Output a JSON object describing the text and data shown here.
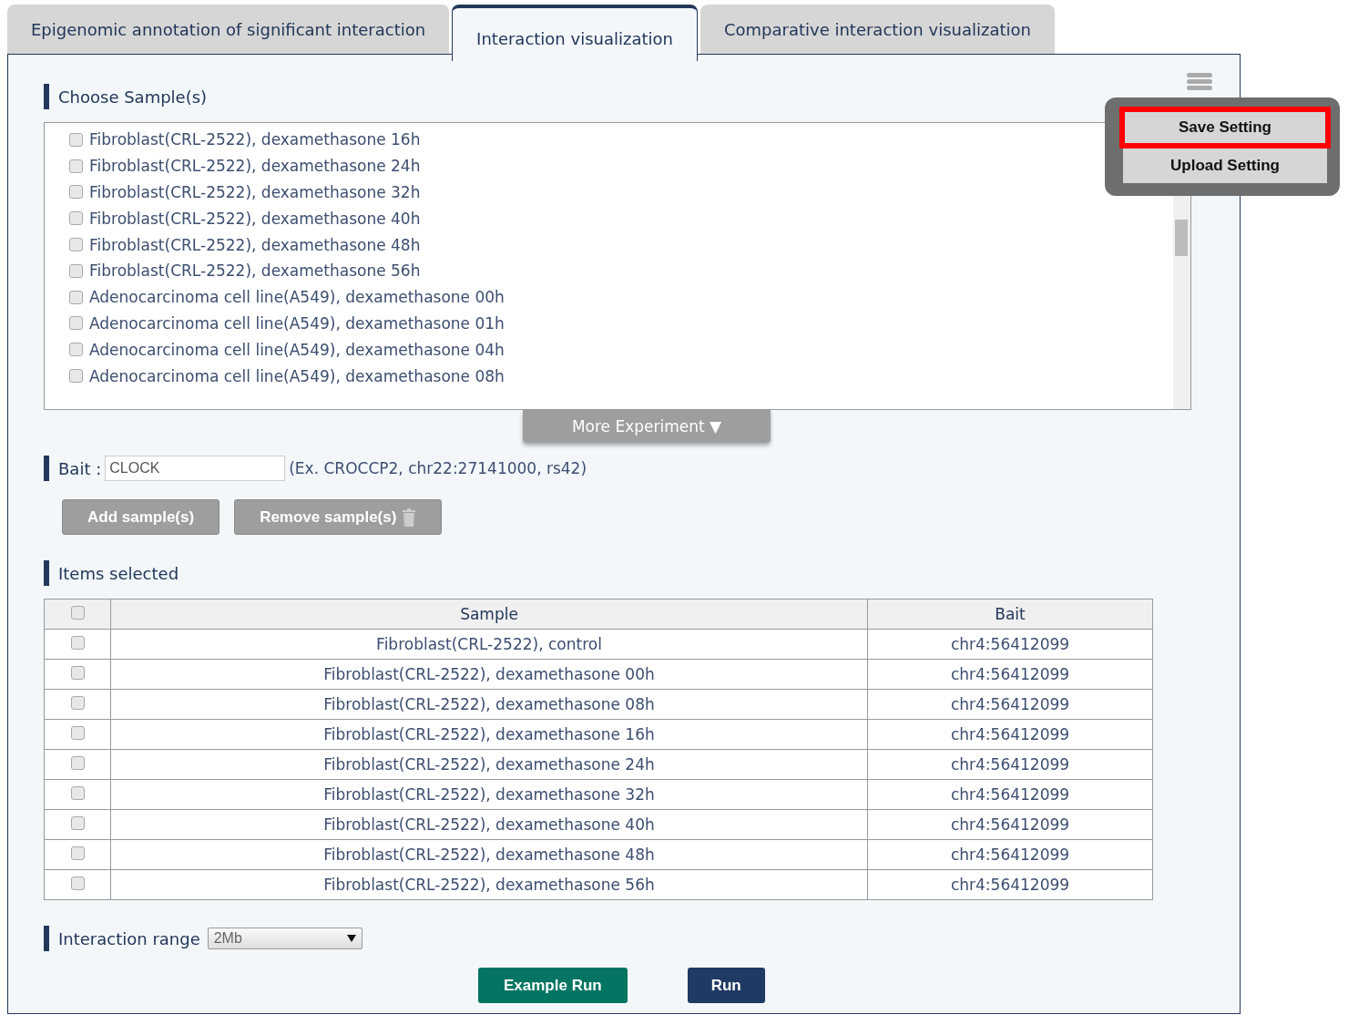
{
  "tabs": [
    {
      "label": "Epigenomic annotation of significant interaction",
      "selected": false
    },
    {
      "label": "Interaction visualization",
      "selected": true
    },
    {
      "label": "Comparative interaction visualization",
      "selected": false
    }
  ],
  "settings_menu": {
    "items": [
      {
        "label": "Save Setting",
        "highlighted": true
      },
      {
        "label": "Upload Setting",
        "highlighted": false
      }
    ]
  },
  "choose_samples": {
    "title": "Choose Sample(s)",
    "samples": [
      {
        "label": "Fibroblast(CRL-2522), dexamethasone 16h",
        "checked": false
      },
      {
        "label": "Fibroblast(CRL-2522), dexamethasone 24h",
        "checked": false
      },
      {
        "label": "Fibroblast(CRL-2522), dexamethasone 32h",
        "checked": false
      },
      {
        "label": "Fibroblast(CRL-2522), dexamethasone 40h",
        "checked": false
      },
      {
        "label": "Fibroblast(CRL-2522), dexamethasone 48h",
        "checked": false
      },
      {
        "label": "Fibroblast(CRL-2522), dexamethasone 56h",
        "checked": false
      },
      {
        "label": "Adenocarcinoma cell line(A549), dexamethasone 00h",
        "checked": false
      },
      {
        "label": "Adenocarcinoma cell line(A549), dexamethasone 01h",
        "checked": false
      },
      {
        "label": "Adenocarcinoma cell line(A549), dexamethasone 04h",
        "checked": false
      },
      {
        "label": "Adenocarcinoma cell line(A549), dexamethasone 08h",
        "checked": false
      }
    ],
    "more_button": "More Experiment ▼"
  },
  "bait": {
    "label": "Bait :",
    "value": "CLOCK",
    "hint": "(Ex. CROCCP2, chr22:27141000, rs42)"
  },
  "actions": [
    {
      "label": "Add sample(s)",
      "kind": "add"
    },
    {
      "label": "Remove sample(s)",
      "kind": "remove"
    }
  ],
  "items_selected": {
    "title": "Items selected",
    "all_checked": false,
    "columns": [
      "Sample",
      "Bait"
    ],
    "rows": [
      {
        "sample": "Fibroblast(CRL-2522), control",
        "bait": "chr4:56412099",
        "checked": false
      },
      {
        "sample": "Fibroblast(CRL-2522), dexamethasone 00h",
        "bait": "chr4:56412099",
        "checked": false
      },
      {
        "sample": "Fibroblast(CRL-2522), dexamethasone 08h",
        "bait": "chr4:56412099",
        "checked": false
      },
      {
        "sample": "Fibroblast(CRL-2522), dexamethasone 16h",
        "bait": "chr4:56412099",
        "checked": false
      },
      {
        "sample": "Fibroblast(CRL-2522), dexamethasone 24h",
        "bait": "chr4:56412099",
        "checked": false
      },
      {
        "sample": "Fibroblast(CRL-2522), dexamethasone 32h",
        "bait": "chr4:56412099",
        "checked": false
      },
      {
        "sample": "Fibroblast(CRL-2522), dexamethasone 40h",
        "bait": "chr4:56412099",
        "checked": false
      },
      {
        "sample": "Fibroblast(CRL-2522), dexamethasone 48h",
        "bait": "chr4:56412099",
        "checked": false
      },
      {
        "sample": "Fibroblast(CRL-2522), dexamethasone 56h",
        "bait": "chr4:56412099",
        "checked": false
      }
    ]
  },
  "interaction_range": {
    "label": "Interaction range",
    "value": "2Mb"
  },
  "run_buttons": [
    {
      "label": "Example Run",
      "kind": "example"
    },
    {
      "label": "Run",
      "kind": "run"
    }
  ]
}
